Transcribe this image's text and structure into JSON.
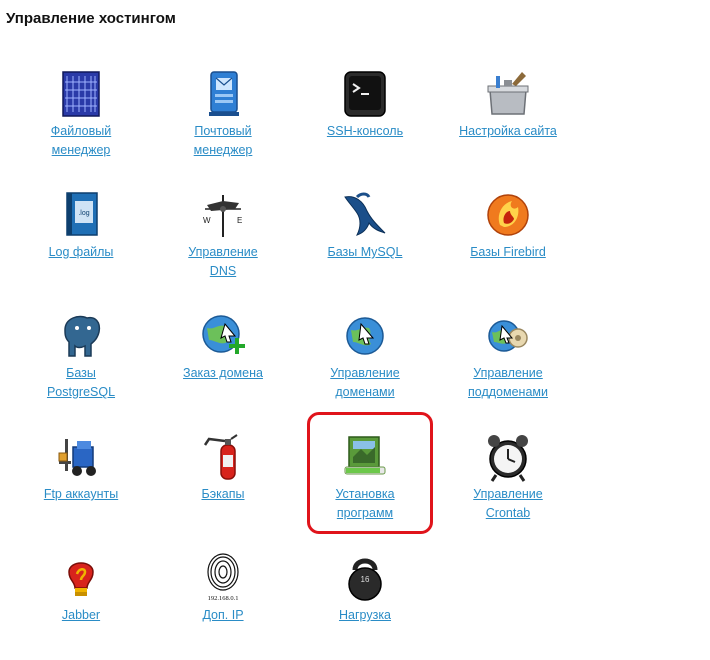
{
  "page": {
    "title": "Управление хостингом"
  },
  "tiles": [
    {
      "label": "Файловый\nменеджер",
      "icon": "file-manager-icon"
    },
    {
      "label": "Почтовый\nменеджер",
      "icon": "mail-manager-icon"
    },
    {
      "label": "SSH-консоль",
      "icon": "terminal-icon"
    },
    {
      "label": "Настройка сайта",
      "icon": "toolbox-icon"
    },
    {
      "label": "Log файлы",
      "icon": "log-book-icon"
    },
    {
      "label": "Управление\nDNS",
      "icon": "weathervane-icon"
    },
    {
      "label": "Базы MySQL",
      "icon": "mysql-dolphin-icon"
    },
    {
      "label": "Базы Firebird",
      "icon": "firebird-icon"
    },
    {
      "label": "Базы\nPostgreSQL",
      "icon": "postgresql-elephant-icon"
    },
    {
      "label": "Заказ домена",
      "icon": "globe-add-icon"
    },
    {
      "label": "Управление\nдоменами",
      "icon": "globe-cursor-icon"
    },
    {
      "label": "Управление\nподдоменами",
      "icon": "globe-gear-icon"
    },
    {
      "label": "Ftp аккаунты",
      "icon": "forklift-icon"
    },
    {
      "label": "Бэкапы",
      "icon": "fire-extinguisher-icon"
    },
    {
      "label": "Установка\nпрограмм",
      "icon": "software-install-icon"
    },
    {
      "label": "Управление\nCrontab",
      "icon": "alarm-clock-icon"
    },
    {
      "label": "Jabber",
      "icon": "jabber-bulb-icon"
    },
    {
      "label": "Доп. IP",
      "icon": "fingerprint-icon",
      "icon_text": "192.168.0.1"
    },
    {
      "label": "Нагрузка",
      "icon": "kettlebell-icon",
      "icon_text": "16"
    }
  ],
  "highlight": {
    "tile": "Установка программ",
    "color": "#e0141b"
  },
  "colors": {
    "link": "#2a8cc6",
    "heading": "#111111"
  }
}
